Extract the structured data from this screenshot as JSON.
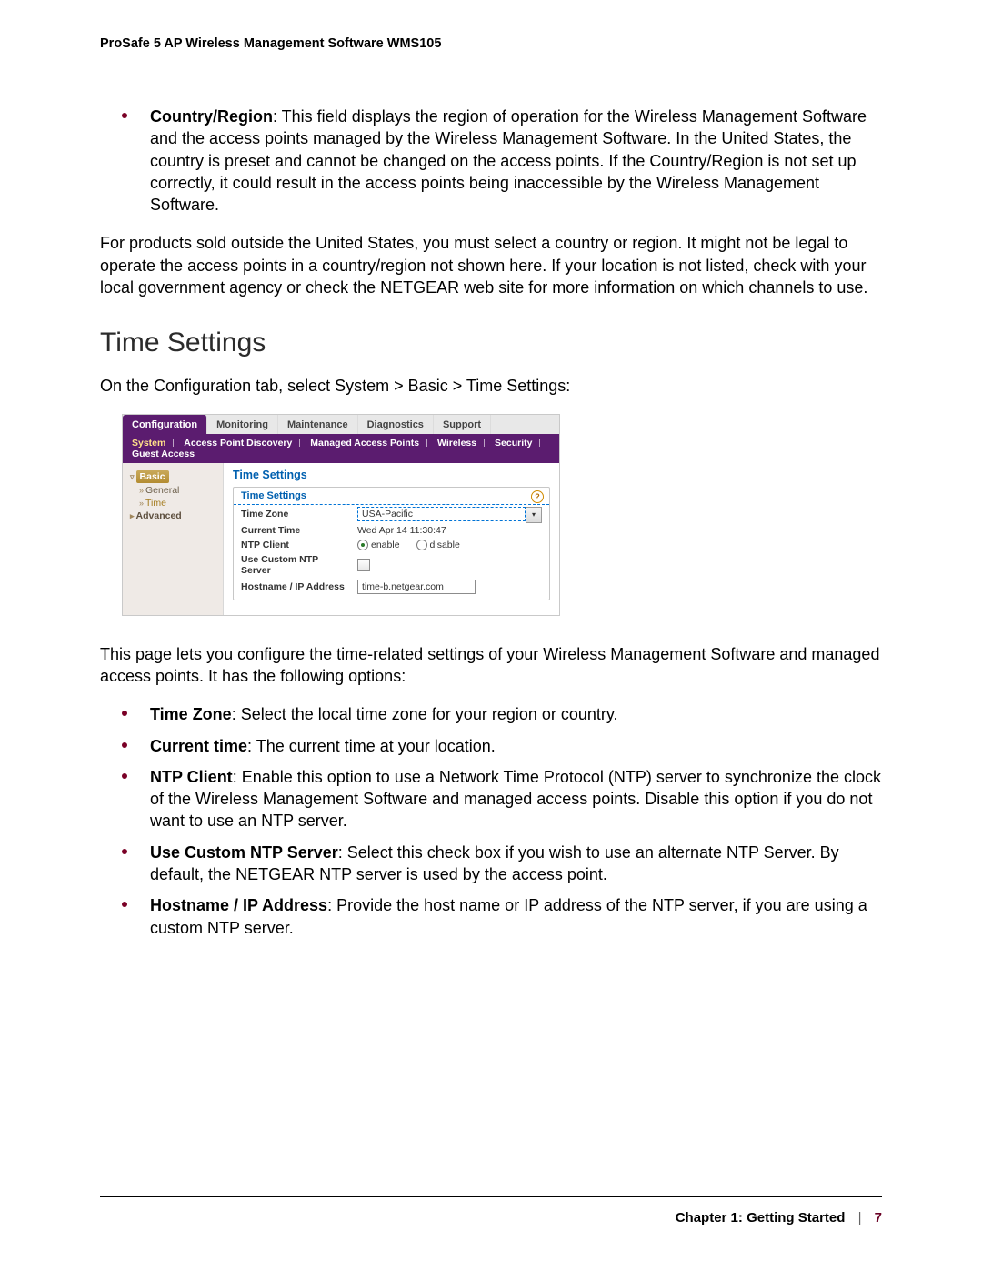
{
  "header": {
    "doc_title": "ProSafe 5 AP Wireless Management Software WMS105"
  },
  "bullet_country": {
    "label": "Country/Region",
    "text": ": This field displays the region of operation for the Wireless Management Software and the access points managed by the Wireless Management Software. In the United States, the country is preset and cannot be changed on the access points. If the Country/Region is not set up correctly, it could result in the access points being inaccessible by the Wireless Management Software."
  },
  "para_non_us": "For products sold outside the United States, you must select a country or region. It might not be legal to operate the access points in a country/region not shown here. If your location is not listed, check with your local government agency or check the NETGEAR web site for more information on which channels to use.",
  "heading_time": "Time Settings",
  "para_path": "On the Configuration tab, select System > Basic > Time Settings:",
  "screenshot": {
    "top_tabs": [
      "Configuration",
      "Monitoring",
      "Maintenance",
      "Diagnostics",
      "Support"
    ],
    "sub_tabs": [
      "System",
      "Access Point Discovery",
      "Managed Access Points",
      "Wireless",
      "Security",
      "Guest Access"
    ],
    "side_tree": {
      "basic": "Basic",
      "general": "General",
      "time": "Time",
      "advanced": "Advanced"
    },
    "panel_title": "Time Settings",
    "box_title": "Time Settings",
    "rows": {
      "tz_label": "Time Zone",
      "tz_value": "USA-Pacific",
      "ct_label": "Current Time",
      "ct_value": "Wed Apr 14 11:30:47",
      "ntp_label": "NTP Client",
      "ntp_enable": "enable",
      "ntp_disable": "disable",
      "custom_label": "Use Custom NTP Server",
      "host_label": "Hostname / IP Address",
      "host_value": "time-b.netgear.com"
    },
    "help_glyph": "?"
  },
  "para_intro2": "This page lets you configure the time-related settings of your Wireless Management Software and managed access points. It has the following options:",
  "bullets2": {
    "tz": {
      "label": "Time Zone",
      "text": ": Select the local time zone for your region or country."
    },
    "ct": {
      "label": "Current time",
      "text": ": The current time at your location."
    },
    "ntp": {
      "label": "NTP Client",
      "text": ": Enable this option to use a Network Time Protocol (NTP) server to synchronize the clock of the Wireless Management Software and managed access points. Disable this option if you do not want to use an NTP server."
    },
    "custom": {
      "label": "Use Custom NTP Server",
      "text": ": Select this check box if you wish to use an alternate NTP Server. By default, the NETGEAR NTP server is used by the access point."
    },
    "host": {
      "label": "Hostname / IP Address",
      "text": ": Provide the host name or IP address of the NTP server, if you are using a custom NTP server."
    }
  },
  "footer": {
    "chapter": "Chapter 1:  Getting Started",
    "page": "7"
  }
}
